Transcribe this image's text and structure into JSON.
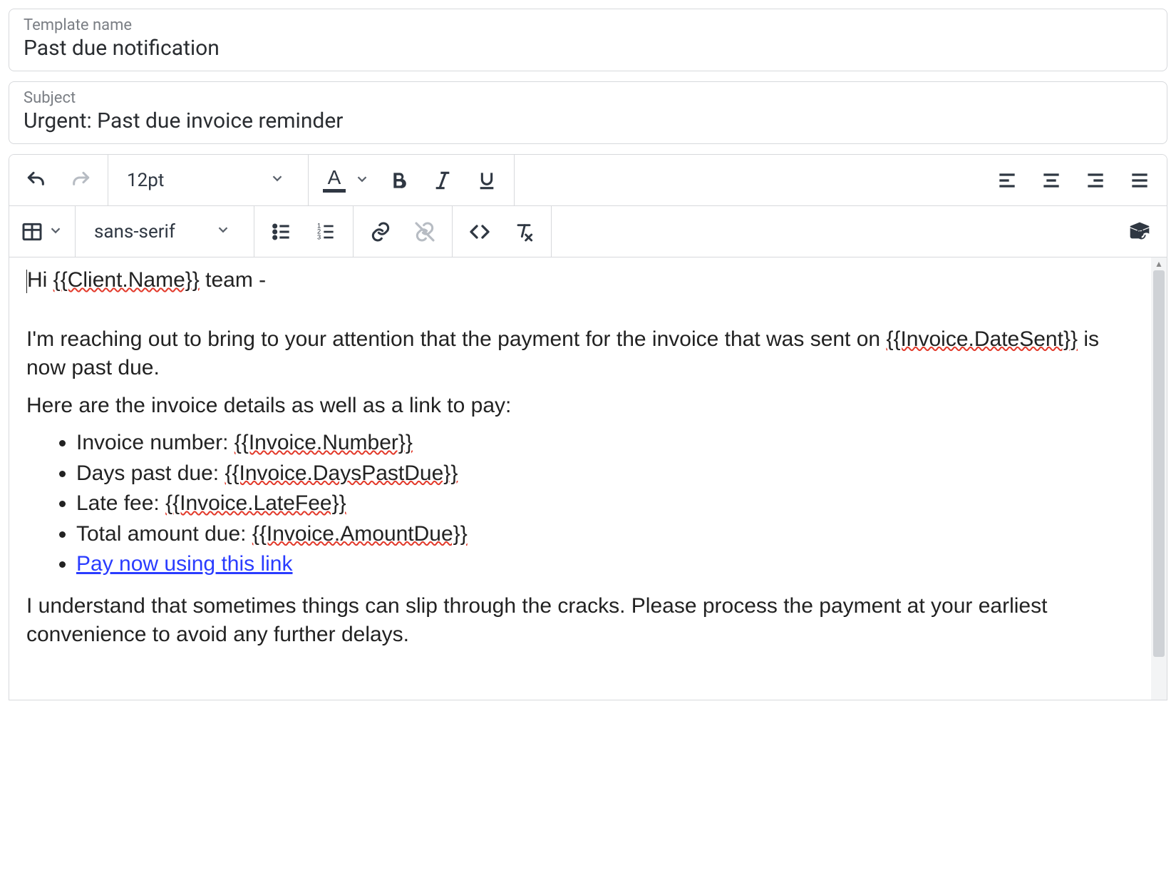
{
  "fields": {
    "templateName": {
      "label": "Template name",
      "value": "Past due notification"
    },
    "subject": {
      "label": "Subject",
      "value": "Urgent: Past due invoice reminder"
    }
  },
  "toolbar": {
    "fontSize": "12pt",
    "fontFamily": "sans-serif"
  },
  "body": {
    "greetingPrefix": "Hi ",
    "greetingVar": "{{Client.Name}}",
    "greetingSuffix": " team -",
    "intro1": "I'm reaching out to bring to your attention that the payment for the invoice that was sent on ",
    "introVar": "{{Invoice.DateSent}}",
    "intro2": " is now past due.",
    "detailsHeader": "Here are the invoice details as well as a link to pay:",
    "bullets": [
      {
        "label": "Invoice number: ",
        "var": "{{Invoice.Number}}"
      },
      {
        "label": "Days past due: ",
        "var": "{{Invoice.DaysPastDue}}"
      },
      {
        "label": "Late fee: ",
        "var": "{{Invoice.LateFee}}"
      },
      {
        "label": "Total amount due: ",
        "var": "{{Invoice.AmountDue}}"
      }
    ],
    "payLinkText": "Pay now using this link",
    "closing": "I understand that sometimes things can slip through the cracks. Please process the payment at your earliest convenience to avoid any further delays."
  }
}
